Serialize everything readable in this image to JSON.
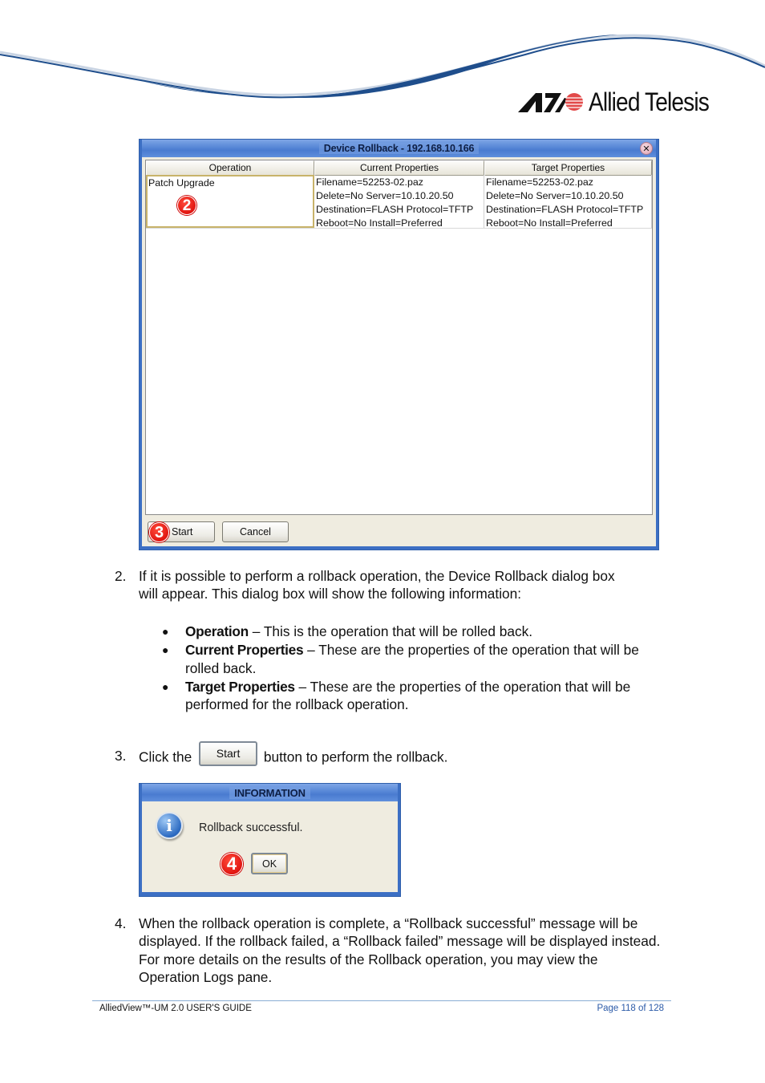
{
  "header": {
    "brand": "Allied Telesis"
  },
  "rollback_dialog": {
    "title": "Device Rollback - 192.168.10.166",
    "close_icon": "close-icon",
    "columns": [
      "Operation",
      "Current Properties",
      "Target Properties"
    ],
    "rows": [
      {
        "operation": "Patch Upgrade",
        "current": [
          "Filename=52253-02.paz",
          "Delete=No Server=10.10.20.50",
          "Destination=FLASH Protocol=TFTP",
          "Reboot=No Install=Preferred"
        ],
        "target": [
          "Filename=52253-02.paz",
          "Delete=No Server=10.10.20.50",
          "Destination=FLASH Protocol=TFTP",
          "Reboot=No Install=Preferred"
        ]
      }
    ],
    "buttons": {
      "start": "Start",
      "cancel": "Cancel"
    },
    "callouts": {
      "row": "2",
      "start": "3"
    }
  },
  "steps": {
    "step2": {
      "number": "2.",
      "text_line1": "If it is possible to perform a rollback operation, the Device Rollback dialog box",
      "text_line2": "will appear. This dialog box will show the following information:",
      "bullets": [
        {
          "term": "Operation",
          "desc": " – This is the operation that will be rolled back."
        },
        {
          "term": "Current Properties",
          "desc": " – These are the properties of the operation that will be rolled back."
        },
        {
          "term": "Target Properties",
          "desc": " – These are the properties of the operation that will be performed for the rollback operation."
        }
      ]
    },
    "step3": {
      "number": "3.",
      "before": "Click the",
      "button": "Start",
      "after": "button to perform the rollback."
    },
    "step4": {
      "number": "4.",
      "lines": [
        "When the rollback operation is complete, a “Rollback successful” message will be",
        "displayed. If the rollback failed, a “Rollback failed” message will be displayed instead.",
        "For more details on the results of the Rollback operation, you may view the",
        "Operation Logs pane."
      ]
    }
  },
  "info_dialog": {
    "title": "INFORMATION",
    "icon": "info-icon",
    "message": "Rollback successful.",
    "ok": "OK",
    "callout": "4"
  },
  "footer": {
    "guide": "AlliedView™-UM 2.0 USER'S GUIDE",
    "page": "Page 118 of 128"
  },
  "colors": {
    "brand_blue": "#1f4e8c",
    "titlebar_blue": "#4a7bd0",
    "callout_red": "#d40000",
    "footer_link": "#2b5aa8"
  }
}
